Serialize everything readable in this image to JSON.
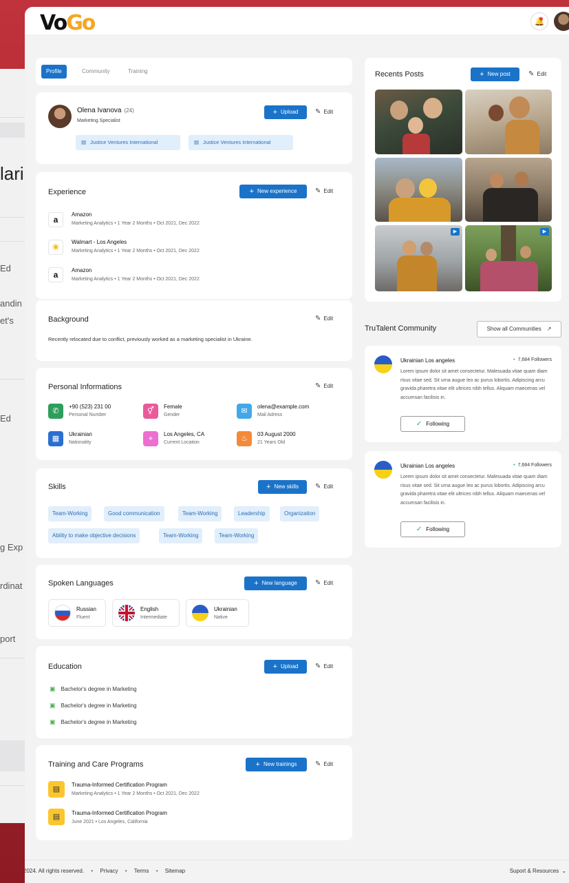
{
  "brand": {
    "logo": "Vo",
    "logo_accent": "Go"
  },
  "background_page": {
    "fragments": [
      "lari",
      "Ed",
      "andin",
      "et's",
      "Ed",
      "g Exp",
      "rdinat",
      "port"
    ]
  },
  "tabs": [
    {
      "label": "Profile",
      "active": true
    },
    {
      "label": "Community",
      "active": false
    },
    {
      "label": "Training",
      "active": false
    }
  ],
  "labels": {
    "upload": "Upload",
    "edit": "Edit"
  },
  "profile": {
    "name": "Olena Ivanova",
    "age": "(24)",
    "title": "Marketing Specialist",
    "organizations": [
      "Justice Ventures International",
      "Justice Ventures International"
    ]
  },
  "experience": {
    "title": "Experience",
    "add_label": "New experience",
    "items": [
      {
        "company": "Amazon",
        "logo": "a",
        "details": "Marketing Analytics  •  1 Year 2 Months  •  Oct 2021, Dec 2022"
      },
      {
        "company": "Walmart - Los Angeles",
        "logo": "✳",
        "details": "Marketing Analytics  •  1 Year 2 Months  •  Oct 2021, Dec 2022"
      },
      {
        "company": "Amazon",
        "logo": "a",
        "details": "Marketing Analytics  •  1 Year 2 Months  •  Oct 2021, Dec 2022"
      }
    ]
  },
  "background": {
    "title": "Background",
    "text": "Recently relocated due to conflict, previously worked as a marketing specialist in Ukraine."
  },
  "personal": {
    "title": "Personal Informations",
    "items": [
      {
        "value": "+90 (523) 231 00",
        "label": "Personal Number",
        "icon": "phone-icon",
        "color": "#2e9e5b"
      },
      {
        "value": "Female",
        "label": "Gender",
        "icon": "gender-icon",
        "color": "#ea5a9a"
      },
      {
        "value": "olena@example.com",
        "label": "Mail Adress",
        "icon": "mail-icon",
        "color": "#43a8e8"
      },
      {
        "value": "Ukrainian",
        "label": "Nationality",
        "icon": "map-icon",
        "color": "#2a6fd0"
      },
      {
        "value": "Los Angeles, CA",
        "label": "Current Location",
        "icon": "location-icon",
        "color": "#ee6fcf"
      },
      {
        "value": "03 August 2000",
        "label": "21 Years Old",
        "icon": "cake-icon",
        "color": "#f28a3a"
      }
    ]
  },
  "skills": {
    "title": "Skills",
    "add_label": "New skills",
    "items": [
      "Team-Working",
      "Good communication",
      "Team-Working",
      "Leadership",
      "Organization",
      "Ability to make objective decisions",
      "Team-Working",
      "Team-Working"
    ]
  },
  "languages": {
    "title": "Spoken Languages",
    "add_label": "New language",
    "items": [
      {
        "name": "Russian",
        "level": "Fluent",
        "flag": "russia"
      },
      {
        "name": "English",
        "level": "Intermediate",
        "flag": "uk"
      },
      {
        "name": "Ukrainian",
        "level": "Native",
        "flag": "ukraine"
      }
    ]
  },
  "education": {
    "title": "Education",
    "items": [
      "Bachelor's degree in Marketing",
      "Bachelor's degree in Marketing",
      "Bachelor's degree in Marketing"
    ]
  },
  "training": {
    "title": "Training and Care Programs",
    "add_label": "New trainings",
    "items": [
      {
        "name": "Trauma-Informed Certification Program",
        "details": "Marketing Analytics  •  1 Year 2 Months  •  Oct 2021, Dec 2022"
      },
      {
        "name": "Trauma-Informed Certification Program",
        "details": "June 2021  •  Los Angeles, California"
      }
    ]
  },
  "recent_posts": {
    "title": "Recents Posts",
    "add_label": "New post"
  },
  "community": {
    "title": "TruTalent Community",
    "show_all": "Show all Communities",
    "items": [
      {
        "name": "Ukrainian Los angeles",
        "followers": "7,684 Followers",
        "description": "Lorem ipsum dolor sit amet consectetur. Malesuada vitae quam diam risus vitae sed. Sit urna augue leo ac purus lobortis. Adipiscing arcu gravida pharetra vitae elit ultrices nibh tellus. Aliquam maecenas vel accumsan facilisis in.",
        "button": "Following"
      },
      {
        "name": "Ukrainian Los angeles",
        "followers": "7,684 Followers",
        "description": "Lorem ipsum dolor sit amet consectetur. Malesuada vitae quam diam risus vitae sed. Sit urna augue leo ac purus lobortis. Adipiscing arcu gravida pharetra vitae elit ultrices nibh tellus. Aliquam maecenas vel accumsan facilisis in.",
        "button": "Following"
      }
    ]
  },
  "footer": {
    "copyright": "2024. All rights reserved.",
    "links": [
      "Privacy",
      "Terms",
      "Sitemap"
    ],
    "support": "Suport & Resources"
  },
  "colors": {
    "primary": "#1a73c9",
    "pill_bg": "#e1eefb",
    "page_bg": "#f3f3f4",
    "frame_red": "#b3262f"
  }
}
